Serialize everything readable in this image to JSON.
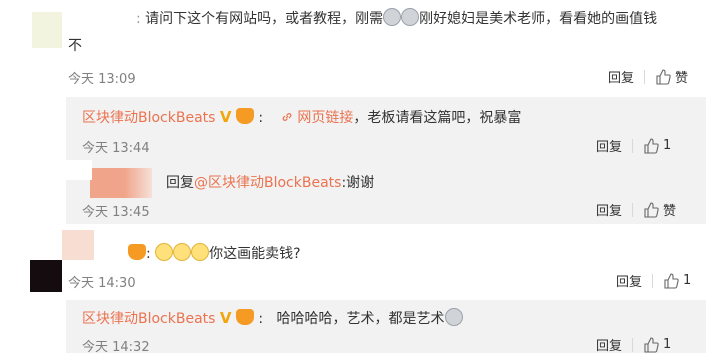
{
  "comment1": {
    "text_line1": "请问下这个有网站吗，或者教程，刚需",
    "text_after_emoji": "刚好媳妇是美术老师，看看她的画值钱",
    "text_line2": "不",
    "time": "今天 13:09",
    "reply_label": "回复",
    "like_label": "赞"
  },
  "reply1": {
    "author": "区块律动BlockBeats",
    "link_text": "网页链接",
    "text": "，老板请看这篇吧，祝暴富",
    "time": "今天 13:44",
    "reply_label": "回复",
    "like_count": "1"
  },
  "reply2": {
    "text_prefix": "回复",
    "mention": "@区块律动BlockBeats",
    "text": ":谢谢",
    "time": "今天 13:45",
    "reply_label": "回复",
    "like_label": "赞"
  },
  "comment2": {
    "text": "你这画能卖钱?",
    "time": "今天 14:30",
    "reply_label": "回复",
    "like_count": "1"
  },
  "reply3": {
    "author": "区块律动BlockBeats",
    "text": "哈哈哈哈，艺术，都是艺术",
    "time": "今天 14:32",
    "reply_label": "回复",
    "like_count": "1"
  },
  "colors": {
    "accent": "#eb7350",
    "reply_bg": "#f2f2f2",
    "muted": "#808080"
  },
  "icons": [
    "thumb-up-icon",
    "link-icon",
    "verified-v-icon",
    "member-crown-icon"
  ]
}
